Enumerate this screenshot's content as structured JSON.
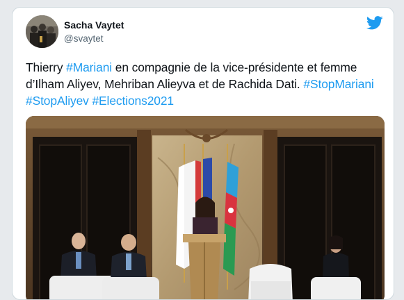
{
  "tweet": {
    "author_name": "Sacha Vaytet",
    "author_handle": "@svaytet",
    "brand_icon": "twitter-bird-icon",
    "accent_color": "#1d9bf0",
    "text_segments": [
      {
        "text": "Thierry ",
        "type": "text"
      },
      {
        "text": "#Mariani",
        "type": "hashtag"
      },
      {
        "text": " en compagnie de la vice-présidente et femme d’Ilham Aliyev, Mehriban Alieyva et de Rachida Dati. ",
        "type": "text"
      },
      {
        "text": "#StopMariani",
        "type": "hashtag"
      },
      {
        "text": " ",
        "type": "text"
      },
      {
        "text": "#StopAliyev",
        "type": "hashtag"
      },
      {
        "text": " ",
        "type": "text"
      },
      {
        "text": "#Elections2021",
        "type": "hashtag"
      }
    ]
  }
}
